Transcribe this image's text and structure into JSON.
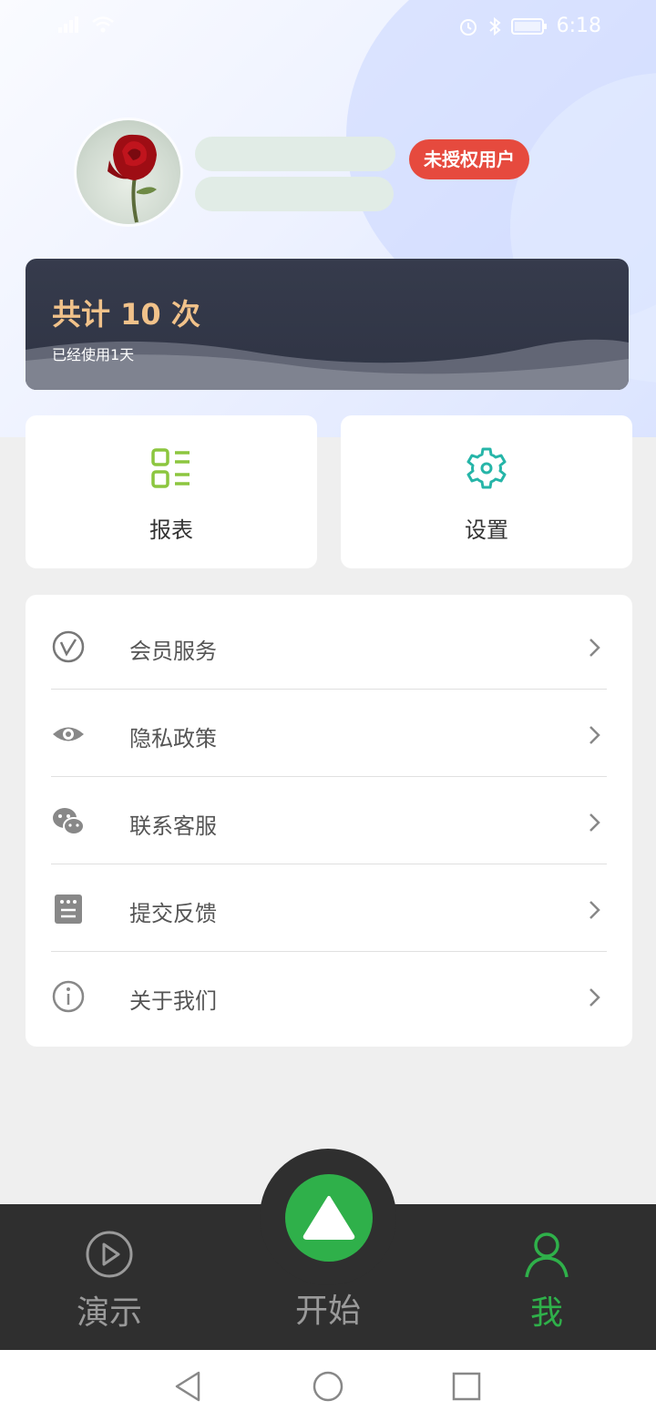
{
  "status_bar": {
    "time": "6:18",
    "icons": [
      "signal-icon",
      "wifi-icon",
      "alarm-icon",
      "bluetooth-icon",
      "battery-icon"
    ]
  },
  "profile": {
    "badge": "未授权用户",
    "avatar_icon": "rose-avatar"
  },
  "stats": {
    "title": "共计 10 次",
    "subtitle": "已经使用1天"
  },
  "tiles": [
    {
      "label": "报表",
      "icon": "report-list-icon"
    },
    {
      "label": "设置",
      "icon": "gear-icon"
    }
  ],
  "menu": [
    {
      "label": "会员服务",
      "icon": "vip-icon"
    },
    {
      "label": "隐私政策",
      "icon": "eye-icon"
    },
    {
      "label": "联系客服",
      "icon": "wechat-icon"
    },
    {
      "label": "提交反馈",
      "icon": "feedback-icon"
    },
    {
      "label": "关于我们",
      "icon": "info-icon"
    }
  ],
  "bottom_nav": {
    "demo": "演示",
    "start": "开始",
    "me": "我",
    "active": "me"
  },
  "colors": {
    "accent": "#2fb04a",
    "badge": "#e64a3e",
    "stats_card": "#363b4c",
    "stats_title": "#f1c28a",
    "report_icon": "#8cc63f",
    "settings_icon": "#26b5a8"
  }
}
